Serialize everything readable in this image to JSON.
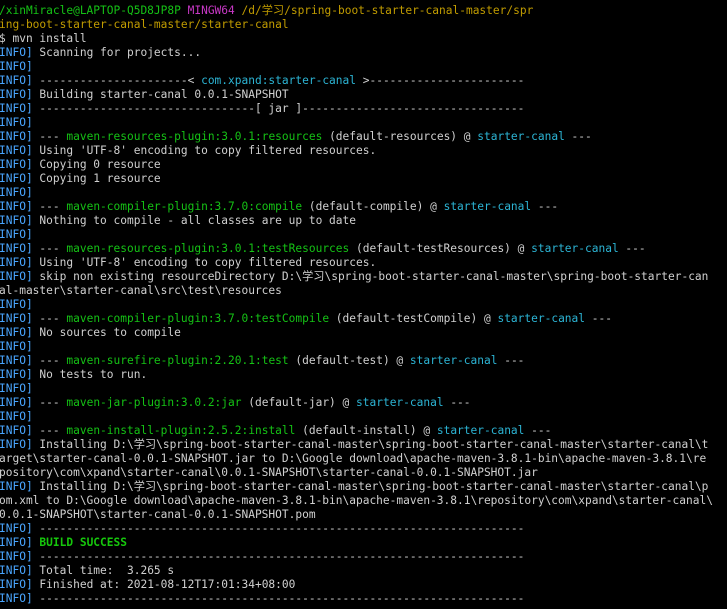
{
  "prompt": {
    "user_host": "/xinMiracle@LAPTOP-Q5D8JP8P",
    "shell": "MINGW64",
    "path_line1": "/d/学习/spring-boot-starter-canal-master/spr",
    "path_line2": "ing-boot-starter-canal-master/starter-canal",
    "command": "$ mvn install"
  },
  "lines": [
    {
      "tag": "INFO]",
      "parts": [
        {
          "t": " Scanning for projects...",
          "c": "w"
        }
      ]
    },
    {
      "tag": "INFO]",
      "parts": []
    },
    {
      "tag": "INFO]",
      "parts": [
        {
          "t": " ----------------------< ",
          "c": "w"
        },
        {
          "t": "com.xpand:starter-canal",
          "c": "c"
        },
        {
          "t": " >-----------------------",
          "c": "w"
        }
      ]
    },
    {
      "tag": "INFO]",
      "parts": [
        {
          "t": " Building starter-canal 0.0.1-SNAPSHOT",
          "c": "w"
        }
      ]
    },
    {
      "tag": "INFO]",
      "parts": [
        {
          "t": " --------------------------------[ jar ]---------------------------------",
          "c": "w"
        }
      ]
    },
    {
      "tag": "INFO]",
      "parts": []
    },
    {
      "tag": "INFO]",
      "parts": [
        {
          "t": " --- ",
          "c": "w"
        },
        {
          "t": "maven-resources-plugin:3.0.1:resources",
          "c": "g"
        },
        {
          "t": " (default-resources) @ ",
          "c": "w"
        },
        {
          "t": "starter-canal",
          "c": "c"
        },
        {
          "t": " ---",
          "c": "w"
        }
      ]
    },
    {
      "tag": "INFO]",
      "parts": [
        {
          "t": " Using 'UTF-8' encoding to copy filtered resources.",
          "c": "w"
        }
      ]
    },
    {
      "tag": "INFO]",
      "parts": [
        {
          "t": " Copying 0 resource",
          "c": "w"
        }
      ]
    },
    {
      "tag": "INFO]",
      "parts": [
        {
          "t": " Copying 1 resource",
          "c": "w"
        }
      ]
    },
    {
      "tag": "INFO]",
      "parts": []
    },
    {
      "tag": "INFO]",
      "parts": [
        {
          "t": " --- ",
          "c": "w"
        },
        {
          "t": "maven-compiler-plugin:3.7.0:compile",
          "c": "g"
        },
        {
          "t": " (default-compile) @ ",
          "c": "w"
        },
        {
          "t": "starter-canal",
          "c": "c"
        },
        {
          "t": " ---",
          "c": "w"
        }
      ]
    },
    {
      "tag": "INFO]",
      "parts": [
        {
          "t": " Nothing to compile - all classes are up to date",
          "c": "w"
        }
      ]
    },
    {
      "tag": "INFO]",
      "parts": []
    },
    {
      "tag": "INFO]",
      "parts": [
        {
          "t": " --- ",
          "c": "w"
        },
        {
          "t": "maven-resources-plugin:3.0.1:testResources",
          "c": "g"
        },
        {
          "t": " (default-testResources) @ ",
          "c": "w"
        },
        {
          "t": "starter-canal",
          "c": "c"
        },
        {
          "t": " ---",
          "c": "w"
        }
      ]
    },
    {
      "tag": "INFO]",
      "parts": [
        {
          "t": " Using 'UTF-8' encoding to copy filtered resources.",
          "c": "w"
        }
      ]
    },
    {
      "tag": "INFO]",
      "parts": [
        {
          "t": " skip non existing resourceDirectory D:\\学习\\spring-boot-starter-canal-master\\spring-boot-starter-can",
          "c": "w"
        }
      ]
    },
    {
      "tag": "",
      "parts": [
        {
          "t": "al-master\\starter-canal\\src\\test\\resources",
          "c": "w"
        }
      ]
    },
    {
      "tag": "INFO]",
      "parts": []
    },
    {
      "tag": "INFO]",
      "parts": [
        {
          "t": " --- ",
          "c": "w"
        },
        {
          "t": "maven-compiler-plugin:3.7.0:testCompile",
          "c": "g"
        },
        {
          "t": " (default-testCompile) @ ",
          "c": "w"
        },
        {
          "t": "starter-canal",
          "c": "c"
        },
        {
          "t": " ---",
          "c": "w"
        }
      ]
    },
    {
      "tag": "INFO]",
      "parts": [
        {
          "t": " No sources to compile",
          "c": "w"
        }
      ]
    },
    {
      "tag": "INFO]",
      "parts": []
    },
    {
      "tag": "INFO]",
      "parts": [
        {
          "t": " --- ",
          "c": "w"
        },
        {
          "t": "maven-surefire-plugin:2.20.1:test",
          "c": "g"
        },
        {
          "t": " (default-test) @ ",
          "c": "w"
        },
        {
          "t": "starter-canal",
          "c": "c"
        },
        {
          "t": " ---",
          "c": "w"
        }
      ]
    },
    {
      "tag": "INFO]",
      "parts": [
        {
          "t": " No tests to run.",
          "c": "w"
        }
      ]
    },
    {
      "tag": "INFO]",
      "parts": []
    },
    {
      "tag": "INFO]",
      "parts": [
        {
          "t": " --- ",
          "c": "w"
        },
        {
          "t": "maven-jar-plugin:3.0.2:jar",
          "c": "g"
        },
        {
          "t": " (default-jar) @ ",
          "c": "w"
        },
        {
          "t": "starter-canal",
          "c": "c"
        },
        {
          "t": " ---",
          "c": "w"
        }
      ]
    },
    {
      "tag": "INFO]",
      "parts": []
    },
    {
      "tag": "INFO]",
      "parts": [
        {
          "t": " --- ",
          "c": "w"
        },
        {
          "t": "maven-install-plugin:2.5.2:install",
          "c": "g"
        },
        {
          "t": " (default-install) @ ",
          "c": "w"
        },
        {
          "t": "starter-canal",
          "c": "c"
        },
        {
          "t": " ---",
          "c": "w"
        }
      ]
    },
    {
      "tag": "INFO]",
      "parts": [
        {
          "t": " Installing D:\\学习\\spring-boot-starter-canal-master\\spring-boot-starter-canal-master\\starter-canal\\t",
          "c": "w"
        }
      ]
    },
    {
      "tag": "",
      "parts": [
        {
          "t": "arget\\starter-canal-0.0.1-SNAPSHOT.jar to D:\\Google download\\apache-maven-3.8.1-bin\\apache-maven-3.8.1\\re",
          "c": "w"
        }
      ]
    },
    {
      "tag": "",
      "parts": [
        {
          "t": "pository\\com\\xpand\\starter-canal\\0.0.1-SNAPSHOT\\starter-canal-0.0.1-SNAPSHOT.jar",
          "c": "w"
        }
      ]
    },
    {
      "tag": "INFO]",
      "parts": [
        {
          "t": " Installing D:\\学习\\spring-boot-starter-canal-master\\spring-boot-starter-canal-master\\starter-canal\\p",
          "c": "w"
        }
      ]
    },
    {
      "tag": "",
      "parts": [
        {
          "t": "om.xml to D:\\Google download\\apache-maven-3.8.1-bin\\apache-maven-3.8.1\\repository\\com\\xpand\\starter-canal\\",
          "c": "w"
        }
      ]
    },
    {
      "tag": "",
      "parts": [
        {
          "t": "0.0.1-SNAPSHOT\\starter-canal-0.0.1-SNAPSHOT.pom",
          "c": "w"
        }
      ]
    },
    {
      "tag": "INFO]",
      "parts": [
        {
          "t": " ------------------------------------------------------------------------",
          "c": "w"
        }
      ]
    },
    {
      "tag": "INFO]",
      "parts": [
        {
          "t": " BUILD SUCCESS",
          "c": "gb"
        }
      ]
    },
    {
      "tag": "INFO]",
      "parts": [
        {
          "t": " ------------------------------------------------------------------------",
          "c": "w"
        }
      ]
    },
    {
      "tag": "INFO]",
      "parts": [
        {
          "t": " Total time:  3.265 s",
          "c": "w"
        }
      ]
    },
    {
      "tag": "INFO]",
      "parts": [
        {
          "t": " Finished at: 2021-08-12T17:01:34+08:00",
          "c": "w"
        }
      ]
    },
    {
      "tag": "INFO]",
      "parts": [
        {
          "t": " ------------------------------------------------------------------------",
          "c": "w"
        }
      ]
    }
  ]
}
